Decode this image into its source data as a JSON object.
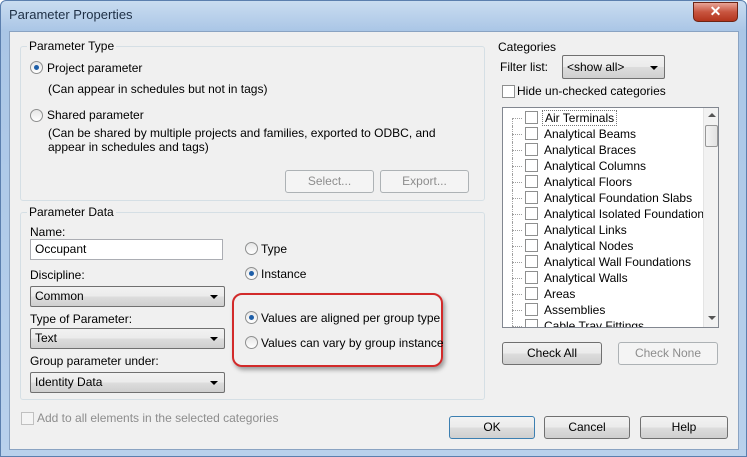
{
  "window": {
    "title": "Parameter Properties",
    "close_glyph": "✕"
  },
  "parameter_type": {
    "label": "Parameter Type",
    "project": {
      "label": "Project parameter",
      "note": "(Can appear in schedules but not in tags)",
      "selected": true
    },
    "shared": {
      "label": "Shared parameter",
      "note_line1": "(Can be shared by multiple projects and families, exported to ODBC, and",
      "note_line2": "appear in schedules and tags)",
      "selected": false
    },
    "select_button": "Select...",
    "export_button": "Export..."
  },
  "parameter_data": {
    "label": "Parameter Data",
    "name_label": "Name:",
    "name_value": "Occupant",
    "discipline_label": "Discipline:",
    "discipline_value": "Common",
    "type_label": "Type of Parameter:",
    "type_value": "Text",
    "group_label": "Group parameter under:",
    "group_value": "Identity Data",
    "type_radio": "Type",
    "instance_radio": "Instance",
    "aligned_radio": "Values are aligned per group type",
    "vary_radio": "Values can vary by group instance"
  },
  "add_to_all": "Add to all elements in the selected categories",
  "categories": {
    "label": "Categories",
    "filter_label": "Filter list:",
    "filter_value": "<show all>",
    "hide_unchecked": "Hide un-checked categories",
    "items": [
      "Air Terminals",
      "Analytical Beams",
      "Analytical Braces",
      "Analytical Columns",
      "Analytical Floors",
      "Analytical Foundation Slabs",
      "Analytical Isolated Foundations",
      "Analytical Links",
      "Analytical Nodes",
      "Analytical Wall Foundations",
      "Analytical Walls",
      "Areas",
      "Assemblies",
      "Cable Tray Fittings"
    ],
    "check_all": "Check All",
    "check_none": "Check None"
  },
  "buttons": {
    "ok": "OK",
    "cancel": "Cancel",
    "help": "Help"
  },
  "colors": {
    "highlight": "#d22a2a",
    "title_bar": "#aac6e6"
  }
}
